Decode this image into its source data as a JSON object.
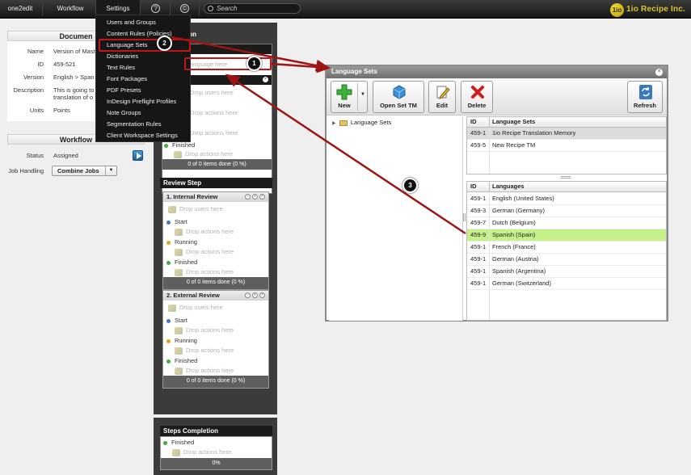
{
  "topbar": {
    "menus": [
      "one2edit",
      "Workflow",
      "Settings"
    ],
    "help_glyph": "?",
    "copyright_glyph": "©",
    "search_placeholder": "Search",
    "logo_mark": "1io",
    "logo_text": "1io Recipe Inc."
  },
  "settings_menu": {
    "items": [
      "Users and Groups",
      "Content Rules (Policies)",
      "Language Sets",
      "Dictionaries",
      "Text Rules",
      "Font Packages",
      "PDF Presets",
      "InDesign Preflight Profiles",
      "Note Groups",
      "Segmentation Rules",
      "Client Workspace Settings"
    ],
    "highlighted_item": "Language Sets"
  },
  "document_panel": {
    "title": "Documen",
    "fields": [
      {
        "label": "Name",
        "value": "Version of Mast"
      },
      {
        "label": "ID",
        "value": "459-521"
      },
      {
        "label": "Version",
        "value": "English > Span"
      },
      {
        "label": "Description",
        "value": "This is going to",
        "value2": "translation of o"
      },
      {
        "label": "Units",
        "value": "Points"
      }
    ]
  },
  "workflow_panel": {
    "title": "Workflow",
    "status_label": "Status",
    "status_value": "Assigned",
    "job_handling_label": "Job Handling",
    "job_handling_value": "Combine Jobs"
  },
  "workflow_column": {
    "top_header_fragment": "ion",
    "language_placeholder": "anguage here",
    "drop_users": "Drop users here",
    "drop_actions": "Drop actions here",
    "finished": "Finished",
    "progress": "0 of 0 items done (0 %)",
    "review_step_title": "Review Step",
    "cards": [
      {
        "title": "1. Internal Review",
        "drop_users": "Drop users here",
        "states": [
          {
            "label": "Start",
            "color": "#3d78c9"
          },
          {
            "label": "Running",
            "color": "#e8a31d"
          },
          {
            "label": "Finished",
            "color": "#3fae3f"
          }
        ],
        "drop_actions": "Drop actions here",
        "progress": "0 of 0 items done (0 %)"
      },
      {
        "title": "2. External Review",
        "drop_users": "Drop users here",
        "states": [
          {
            "label": "Start",
            "color": "#3d78c9"
          },
          {
            "label": "Running",
            "color": "#e8a31d"
          },
          {
            "label": "Finished",
            "color": "#3fae3f"
          }
        ],
        "drop_actions": "Drop actions here",
        "progress": "0 of 0 items done (0 %)"
      }
    ],
    "completion_title": "Steps Completion",
    "completion_finished": "Finished",
    "completion_drop_actions": "Drop actions here",
    "completion_progress": "0%"
  },
  "dialog": {
    "title": "Language Sets",
    "toolbar": {
      "new": "New",
      "open_set_tm": "Open Set TM",
      "edit": "Edit",
      "delete": "Delete",
      "refresh": "Refresh"
    },
    "tree_root": "Language Sets",
    "sets_grid": {
      "columns": [
        "ID",
        "Language Sets"
      ],
      "rows": [
        {
          "id": "459-1",
          "name": "1io Recipe Translation Memory"
        },
        {
          "id": "459-5",
          "name": "New Recipe TM"
        }
      ]
    },
    "languages_grid": {
      "columns": [
        "ID",
        "Languages"
      ],
      "rows": [
        {
          "id": "459-1",
          "name": "English (United States)"
        },
        {
          "id": "459-3",
          "name": "German (Germany)"
        },
        {
          "id": "459-7",
          "name": "Dutch (Belgium)"
        },
        {
          "id": "459-9",
          "name": "Spanish (Spain)"
        },
        {
          "id": "459-1",
          "name": "French (France)"
        },
        {
          "id": "459-1",
          "name": "German (Austria)"
        },
        {
          "id": "459-1",
          "name": "Spanish (Argentina)"
        },
        {
          "id": "459-1",
          "name": "German (Switzerland)"
        }
      ],
      "selected_row": "Spanish (Spain)"
    }
  },
  "callouts": [
    "1",
    "2",
    "3"
  ],
  "colors": {
    "arrow": "#9e1414",
    "selected_row": "#c6f08a",
    "logo": "#d8c62a",
    "highlight_box": "#c01616"
  }
}
